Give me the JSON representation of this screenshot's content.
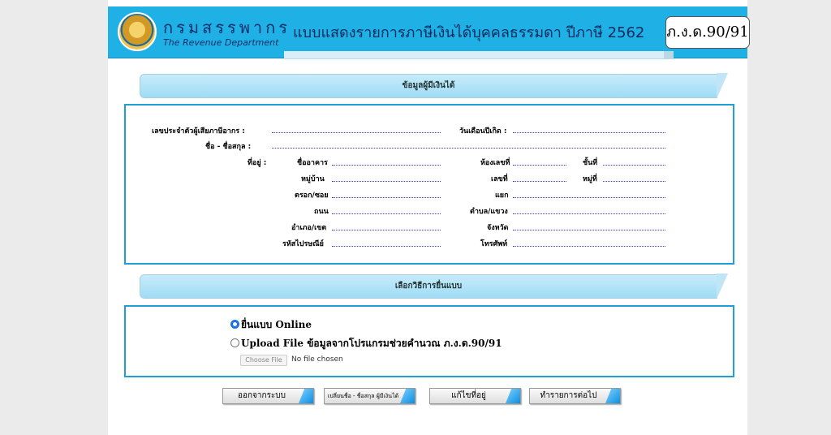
{
  "header": {
    "brand_th": "กรมสรรพากร",
    "brand_en": "The Revenue Department",
    "form_title": "แบบแสดงรายการภาษีเงินได้บุคคลธรรมดา ปีภาษี 2562",
    "form_code": "ภ.ง.ด.90/91"
  },
  "taxpayer_section": {
    "title": "ข้อมูลผู้มีเงินได้",
    "tax_id_label": "เลขประจำตัวผู้เสียภาษีอากร :",
    "birthdate_label": "วันเดือนปีเกิด :",
    "name_label": "ชื่อ - ชื่อสกุล :",
    "address_label": "ที่อยู่ :",
    "building_label": "ชื่ออาคาร",
    "room_label": "ห้องเลขที่",
    "floor_label": "ชั้นที่",
    "village_label": "หมู่บ้าน",
    "house_no_label": "เลขที่",
    "moo_label": "หมู่ที่",
    "soi_label": "ตรอก/ซอย",
    "junction_label": "แยก",
    "road_label": "ถนน",
    "subdistrict_label": "ตำบล/แขวง",
    "district_label": "อำเภอ/เขต",
    "province_label": "จังหวัด",
    "postcode_label": "รหัสไปรษณีย์",
    "phone_label": "โทรศัพท์"
  },
  "filing_section": {
    "title": "เลือกวิธีการยื่นแบบ",
    "option_online": "ยื่นแบบ Online",
    "option_upload": "Upload File ข้อมูลจากโปรแกรมช่วยคำนวณ ภ.ง.ด.90/91",
    "choose_file": "Choose File",
    "no_file": "No file chosen"
  },
  "buttons": {
    "exit": "ออกจากระบบ",
    "change_name": "เปลี่ยนชื่อ - ชื่อสกุล ผู้มีเงินได้",
    "edit_address": "แก้ไขที่อยู่",
    "next": "ทำรายการต่อไป"
  },
  "colors": {
    "header_bg": "#1fb1e6",
    "box_border": "#1f9fd3",
    "radio_selected": "#1a73e8"
  }
}
